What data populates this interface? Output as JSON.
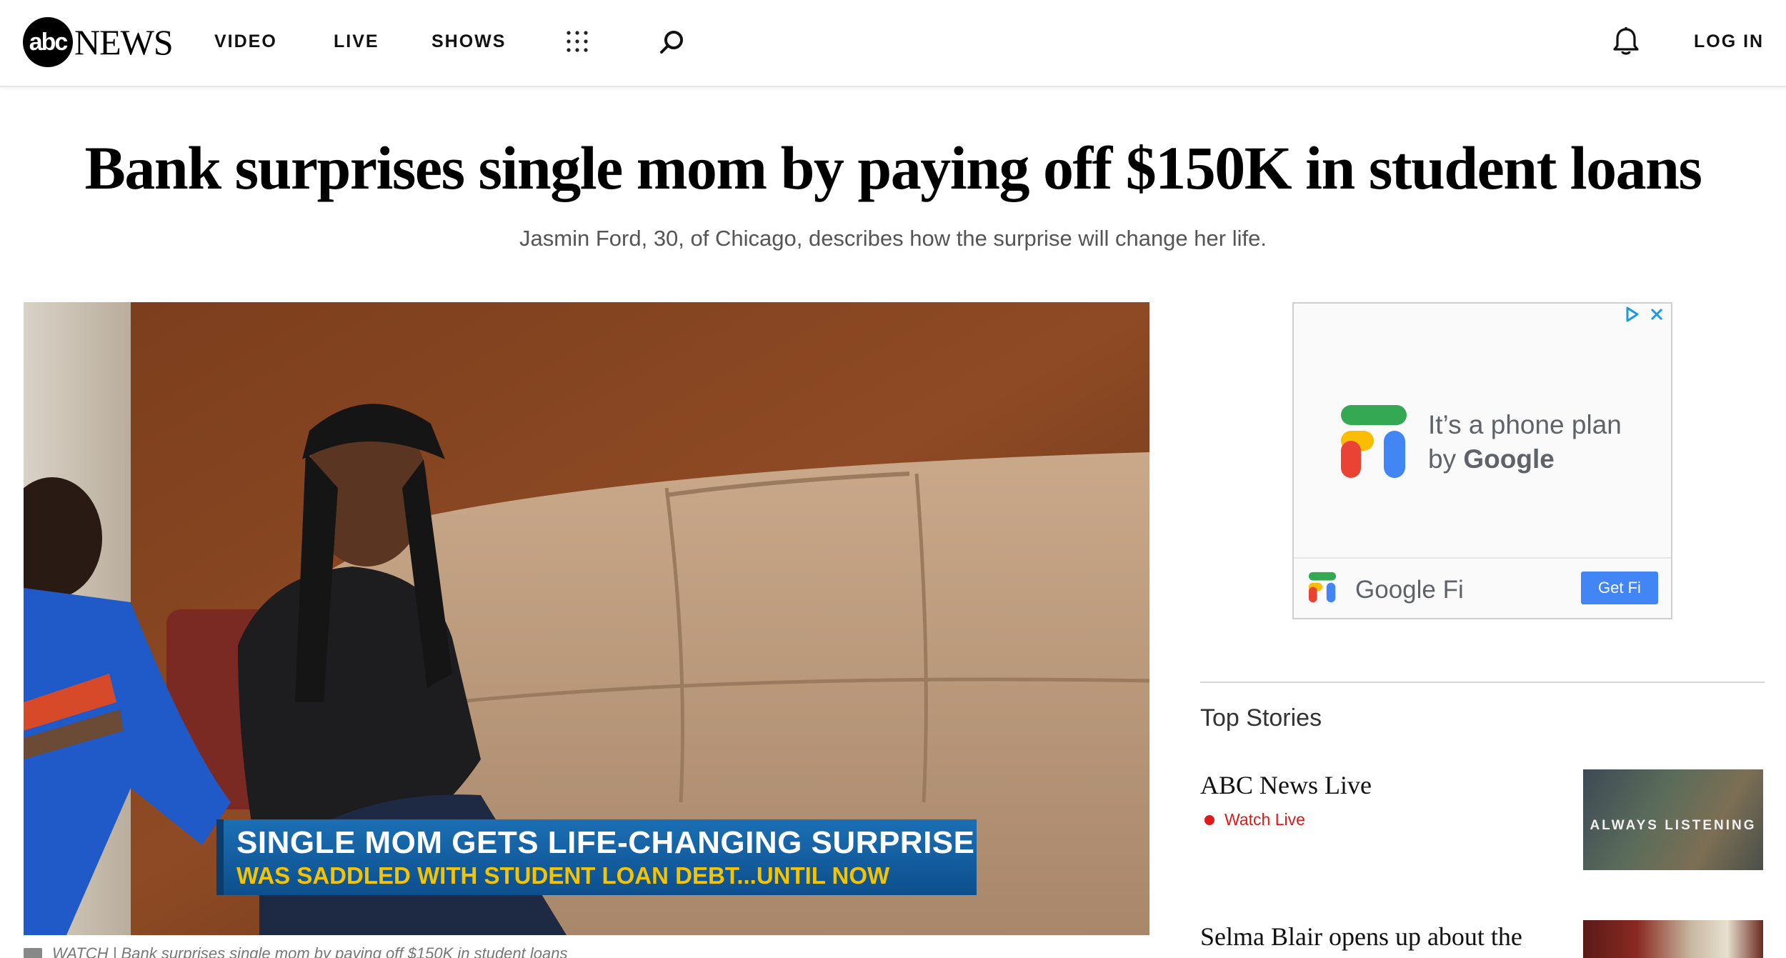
{
  "header": {
    "logo_abc": "abc",
    "logo_news": "NEWS",
    "nav": [
      {
        "label": "VIDEO"
      },
      {
        "label": "LIVE"
      },
      {
        "label": "SHOWS"
      }
    ],
    "login_label": "LOG IN",
    "icons": [
      "apps-grid-icon",
      "search-icon",
      "bell-icon"
    ]
  },
  "article": {
    "title": "Bank surprises single mom by paying off $150K in student loans",
    "subtitle": "Jasmin Ford, 30, of Chicago, describes how the surprise will change her life.",
    "video": {
      "lower_third_line1": "SINGLE MOM GETS LIFE-CHANGING SURPRISE",
      "lower_third_line2": "WAS SADDLED WITH STUDENT LOAN DEBT...UNTIL NOW",
      "caption": "WATCH | Bank surprises single mom by paying off $150K in student loans"
    }
  },
  "ad": {
    "copy_line1": "It’s a phone plan",
    "copy_line2_prefix": "by ",
    "copy_line2_brand": "Google",
    "brand_name": "Google Fi",
    "cta_label": "Get Fi",
    "colors": {
      "blue": "#4285f4",
      "green": "#34a853",
      "yellow": "#fbbc04",
      "red": "#ea4335"
    }
  },
  "top_stories": {
    "heading": "Top Stories",
    "items": [
      {
        "title": "ABC News Live",
        "badge": "Watch Live",
        "thumb_text": "ALWAYS LISTENING"
      },
      {
        "title": "Selma Blair opens up about the"
      }
    ]
  },
  "colors": {
    "live_red": "#e01919",
    "lower_third_blue": "#1b6fb5",
    "lower_third_yellow": "#f5c400"
  }
}
